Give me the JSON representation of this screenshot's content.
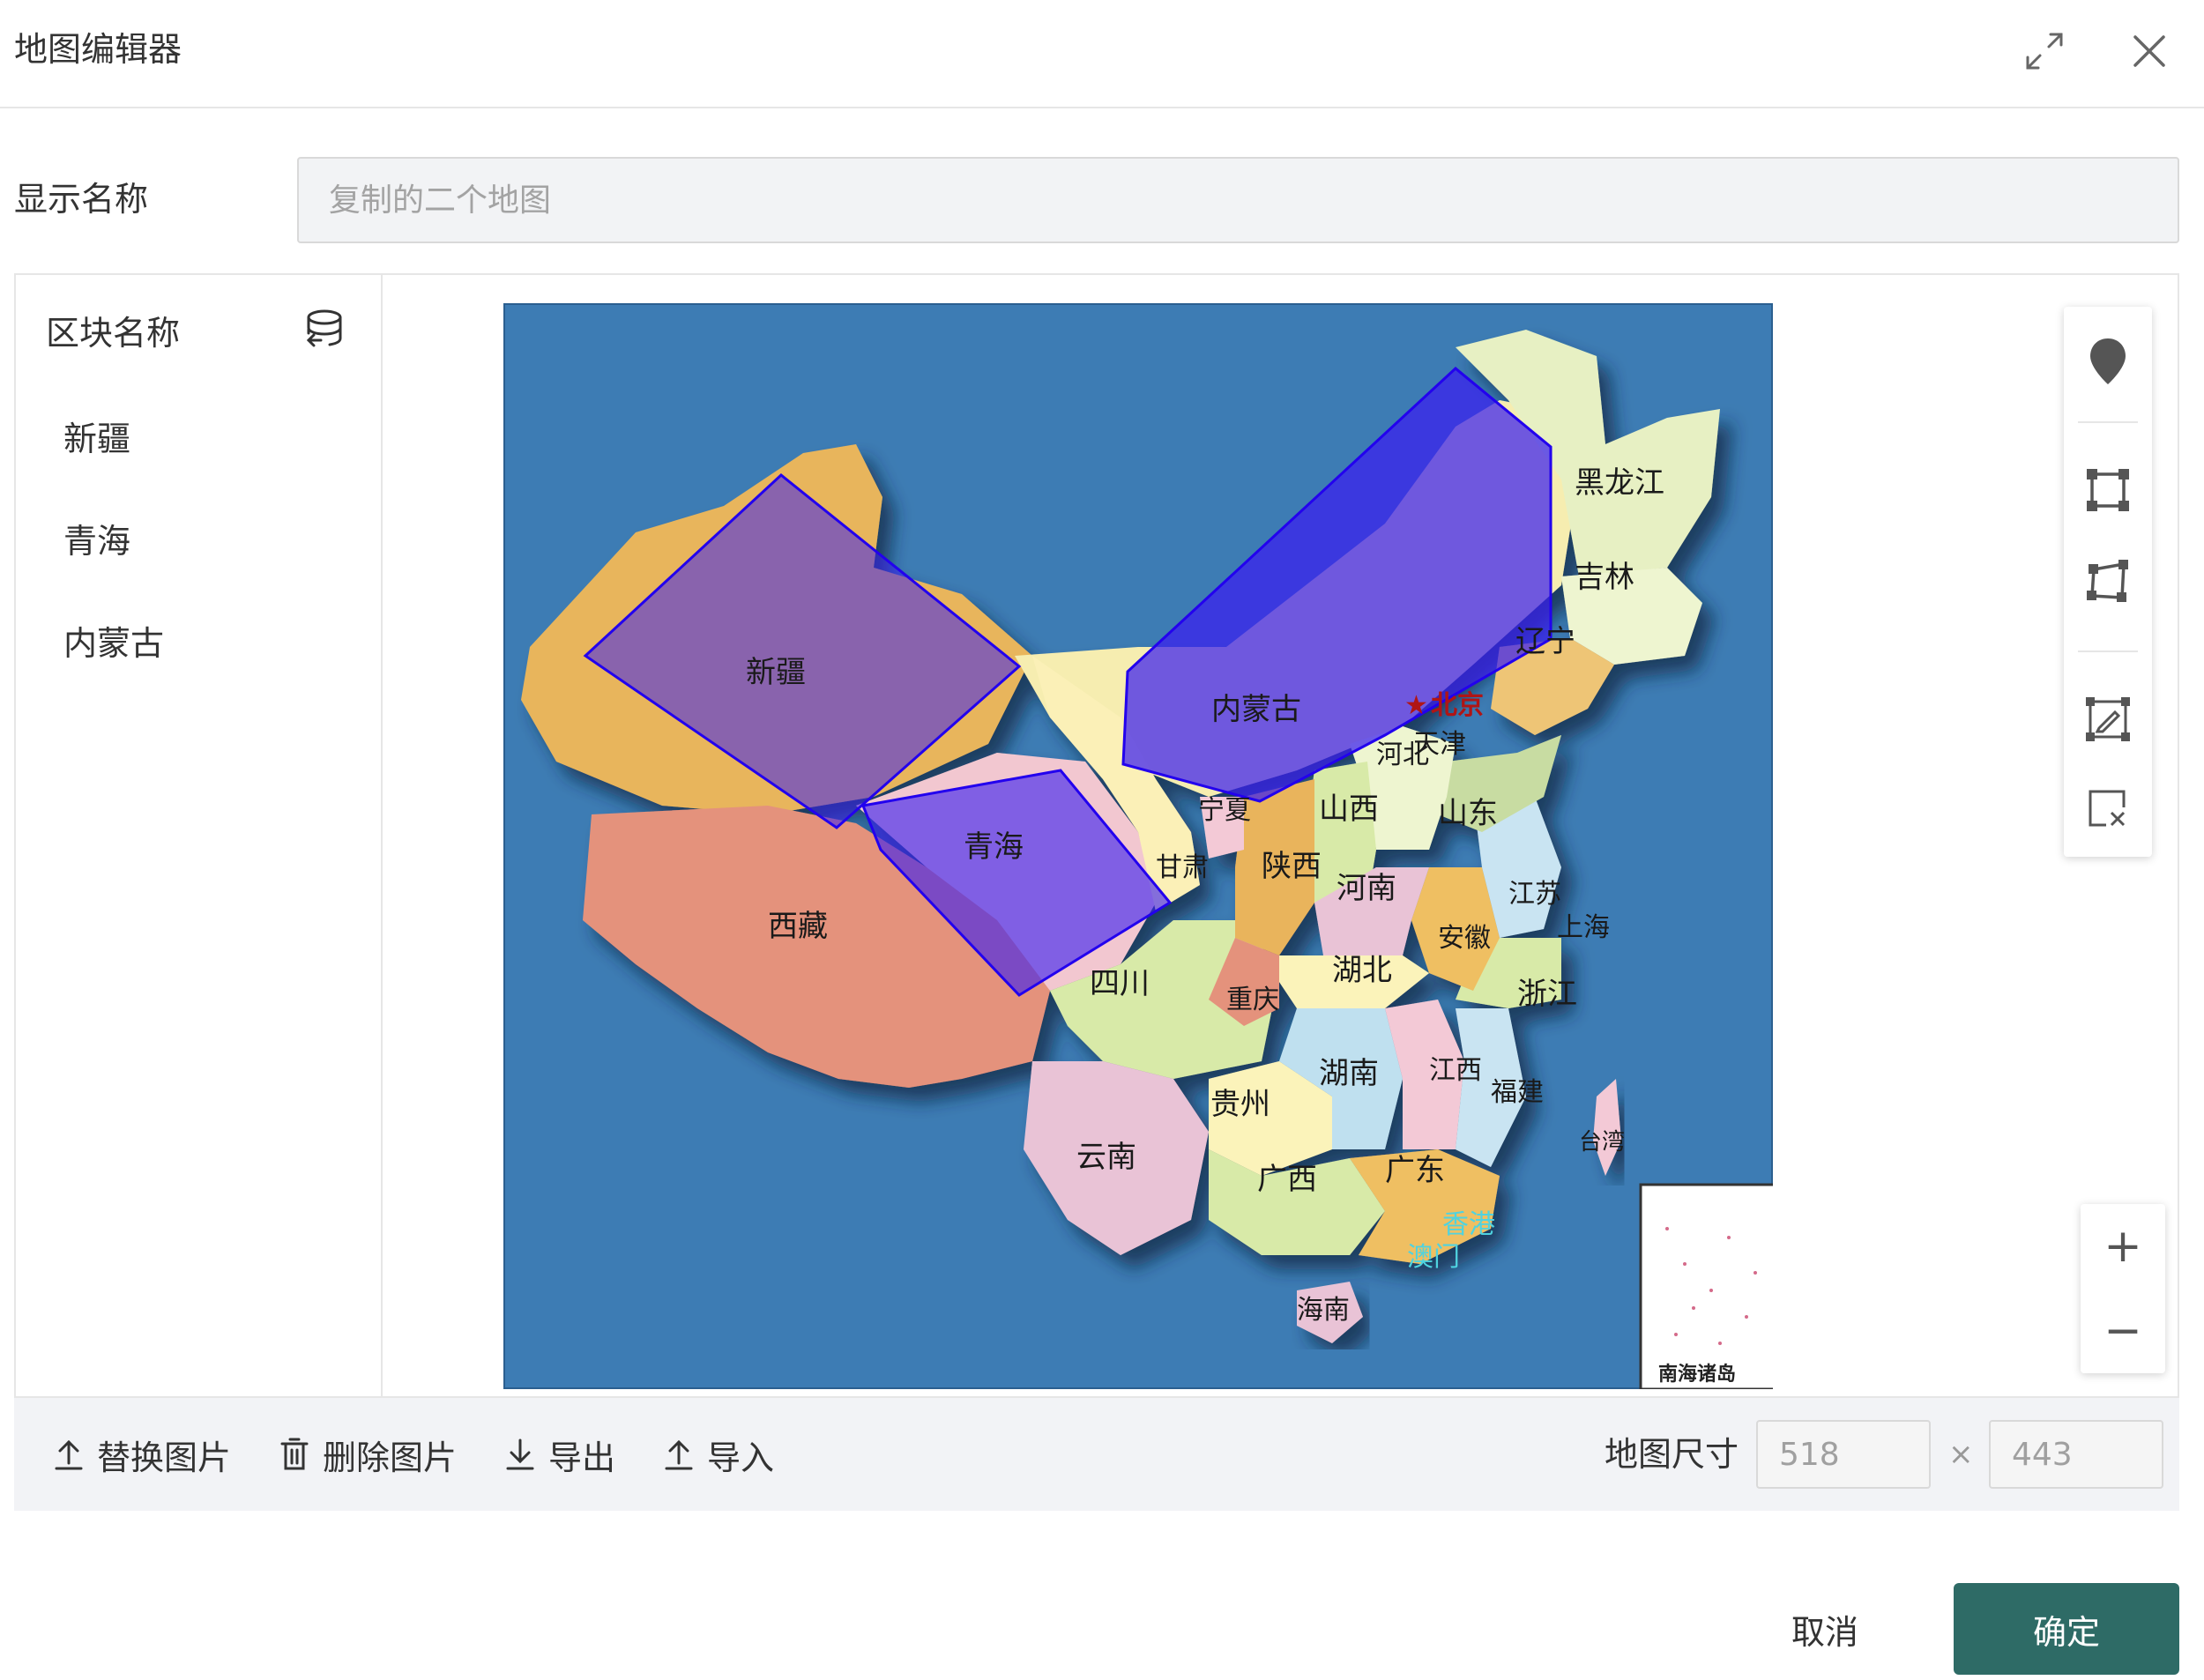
{
  "header": {
    "title": "地图编辑器",
    "fullscreen_icon": "expand-icon",
    "close_icon": "close-icon"
  },
  "name_field": {
    "label": "显示名称",
    "placeholder": "复制的二个地图"
  },
  "region_panel": {
    "heading": "区块名称",
    "icon": "database-import-icon",
    "items": [
      {
        "label": "新疆"
      },
      {
        "label": "青海"
      },
      {
        "label": "内蒙古"
      }
    ]
  },
  "map": {
    "ocean_color": "#3d7cb4",
    "region_fill_color": "#3a1ff0",
    "provinces": [
      "黑龙江",
      "吉林",
      "辽宁",
      "北京",
      "天津",
      "河北",
      "山东",
      "山西",
      "宁夏",
      "甘肃",
      "陕西",
      "河南",
      "江苏",
      "上海",
      "安徽",
      "湖北",
      "浙江",
      "重庆",
      "四川",
      "湖南",
      "江西",
      "福建",
      "台湾",
      "贵州",
      "云南",
      "广西",
      "广东",
      "香港",
      "澳门",
      "海南",
      "西藏"
    ],
    "inset_label": "南海诸岛"
  },
  "tools": {
    "marker": "map-pin-icon",
    "rectangle": "rectangle-draw-icon",
    "polygon": "polygon-draw-icon",
    "edit_shape": "edit-shape-icon",
    "delete_shape": "delete-shape-icon"
  },
  "zoom": {
    "in_label": "+",
    "out_label": "−"
  },
  "bottom_bar": {
    "replace_image": "替换图片",
    "delete_image": "删除图片",
    "export": "导出",
    "import": "导入",
    "size_label": "地图尺寸",
    "width": "518",
    "height": "443",
    "separator": "×"
  },
  "footer": {
    "cancel": "取消",
    "confirm": "确定"
  },
  "colors": {
    "primary": "#2e6b66",
    "panel_bg": "#f2f3f6"
  }
}
